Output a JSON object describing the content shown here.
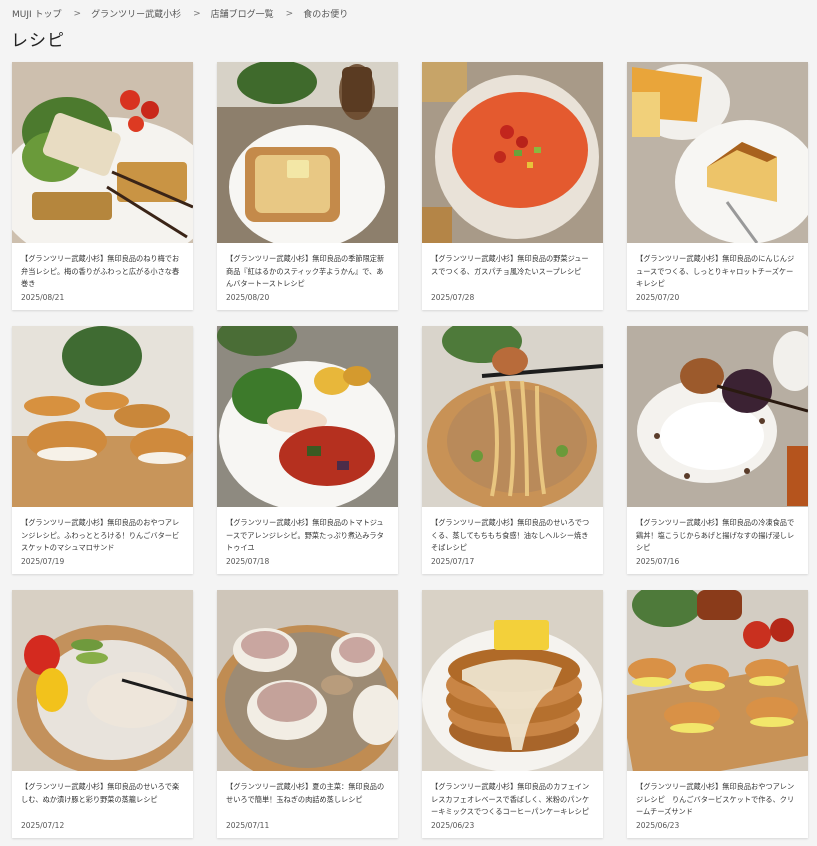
{
  "breadcrumb": [
    {
      "label": "MUJI トップ"
    },
    {
      "label": "グランツリー武蔵小杉"
    },
    {
      "label": "店舗ブログ一覧"
    },
    {
      "label": "食のお便り"
    }
  ],
  "page_title": "レシピ",
  "cards": [
    {
      "title": "【グランツリー武蔵小杉】無印良品のねり梅でお弁当レシピ。梅の香りがふわっと広がる小さな春巻き",
      "date": "2025/08/21",
      "image": "spring-rolls-salad"
    },
    {
      "title": "【グランツリー武蔵小杉】無印良品の季節限定新商品『紅はるかのスティック芋ようかん』で、あんバタートーストレシピ",
      "date": "2025/08/20",
      "image": "anbutter-toast"
    },
    {
      "title": "【グランツリー武蔵小杉】無印良品の野菜ジュースでつくる、ガスパチョ風冷たいスープレシピ",
      "date": "2025/07/28",
      "image": "gazpacho-soup"
    },
    {
      "title": "【グランツリー武蔵小杉】無印良品のにんじんジュースでつくる、しっとりキャロットチーズケーキレシピ",
      "date": "2025/07/20",
      "image": "carrot-cheesecake"
    },
    {
      "title": "【グランツリー武蔵小杉】無印良品のおやつアレンジレシピ。ふわっととろける！りんごバタービスケットのマシュマロサンド",
      "date": "2025/07/19",
      "image": "marshmallow-sandwich"
    },
    {
      "title": "【グランツリー武蔵小杉】無印良品のトマトジュースでアレンジレシピ。野菜たっぷり煮込みラタトゥイユ",
      "date": "2025/07/18",
      "image": "ratatouille-plate"
    },
    {
      "title": "【グランツリー武蔵小杉】無印良品のせいろでつくる、蒸してもちもち食感！油なしヘルシー焼きそばレシピ",
      "date": "2025/07/17",
      "image": "steamed-yakisoba"
    },
    {
      "title": "【グランツリー武蔵小杉】無印良品の冷凍食品で鶏丼！塩こうじからあげと揚げなすの揚げ浸しレシピ",
      "date": "2025/07/16",
      "image": "karaage-rice-bowl"
    },
    {
      "title": "【グランツリー武蔵小杉】無印良品のせいろで楽しむ、ぬか漬け豚と彩り野菜の蒸籠レシピ",
      "date": "2025/07/12",
      "image": "steamed-pork-vegetables"
    },
    {
      "title": "【グランツリー武蔵小杉】夏の主菜：無印良品のせいろで簡単！玉ねぎの肉詰め蒸しレシピ",
      "date": "2025/07/11",
      "image": "stuffed-onion-seiro"
    },
    {
      "title": "【グランツリー武蔵小杉】無印良品のカフェインレスカフェオレベースで香ばしく、米粉のパンケーキミックスでつくるコーヒーパンケーキレシピ",
      "date": "2025/06/23",
      "image": "coffee-pancakes"
    },
    {
      "title": "【グランツリー武蔵小杉】無印良品おやつアレンジレシピ　りんごバタービスケットで作る、クリームチーズサンド",
      "date": "2025/06/23",
      "image": "cream-cheese-sandwich"
    }
  ]
}
